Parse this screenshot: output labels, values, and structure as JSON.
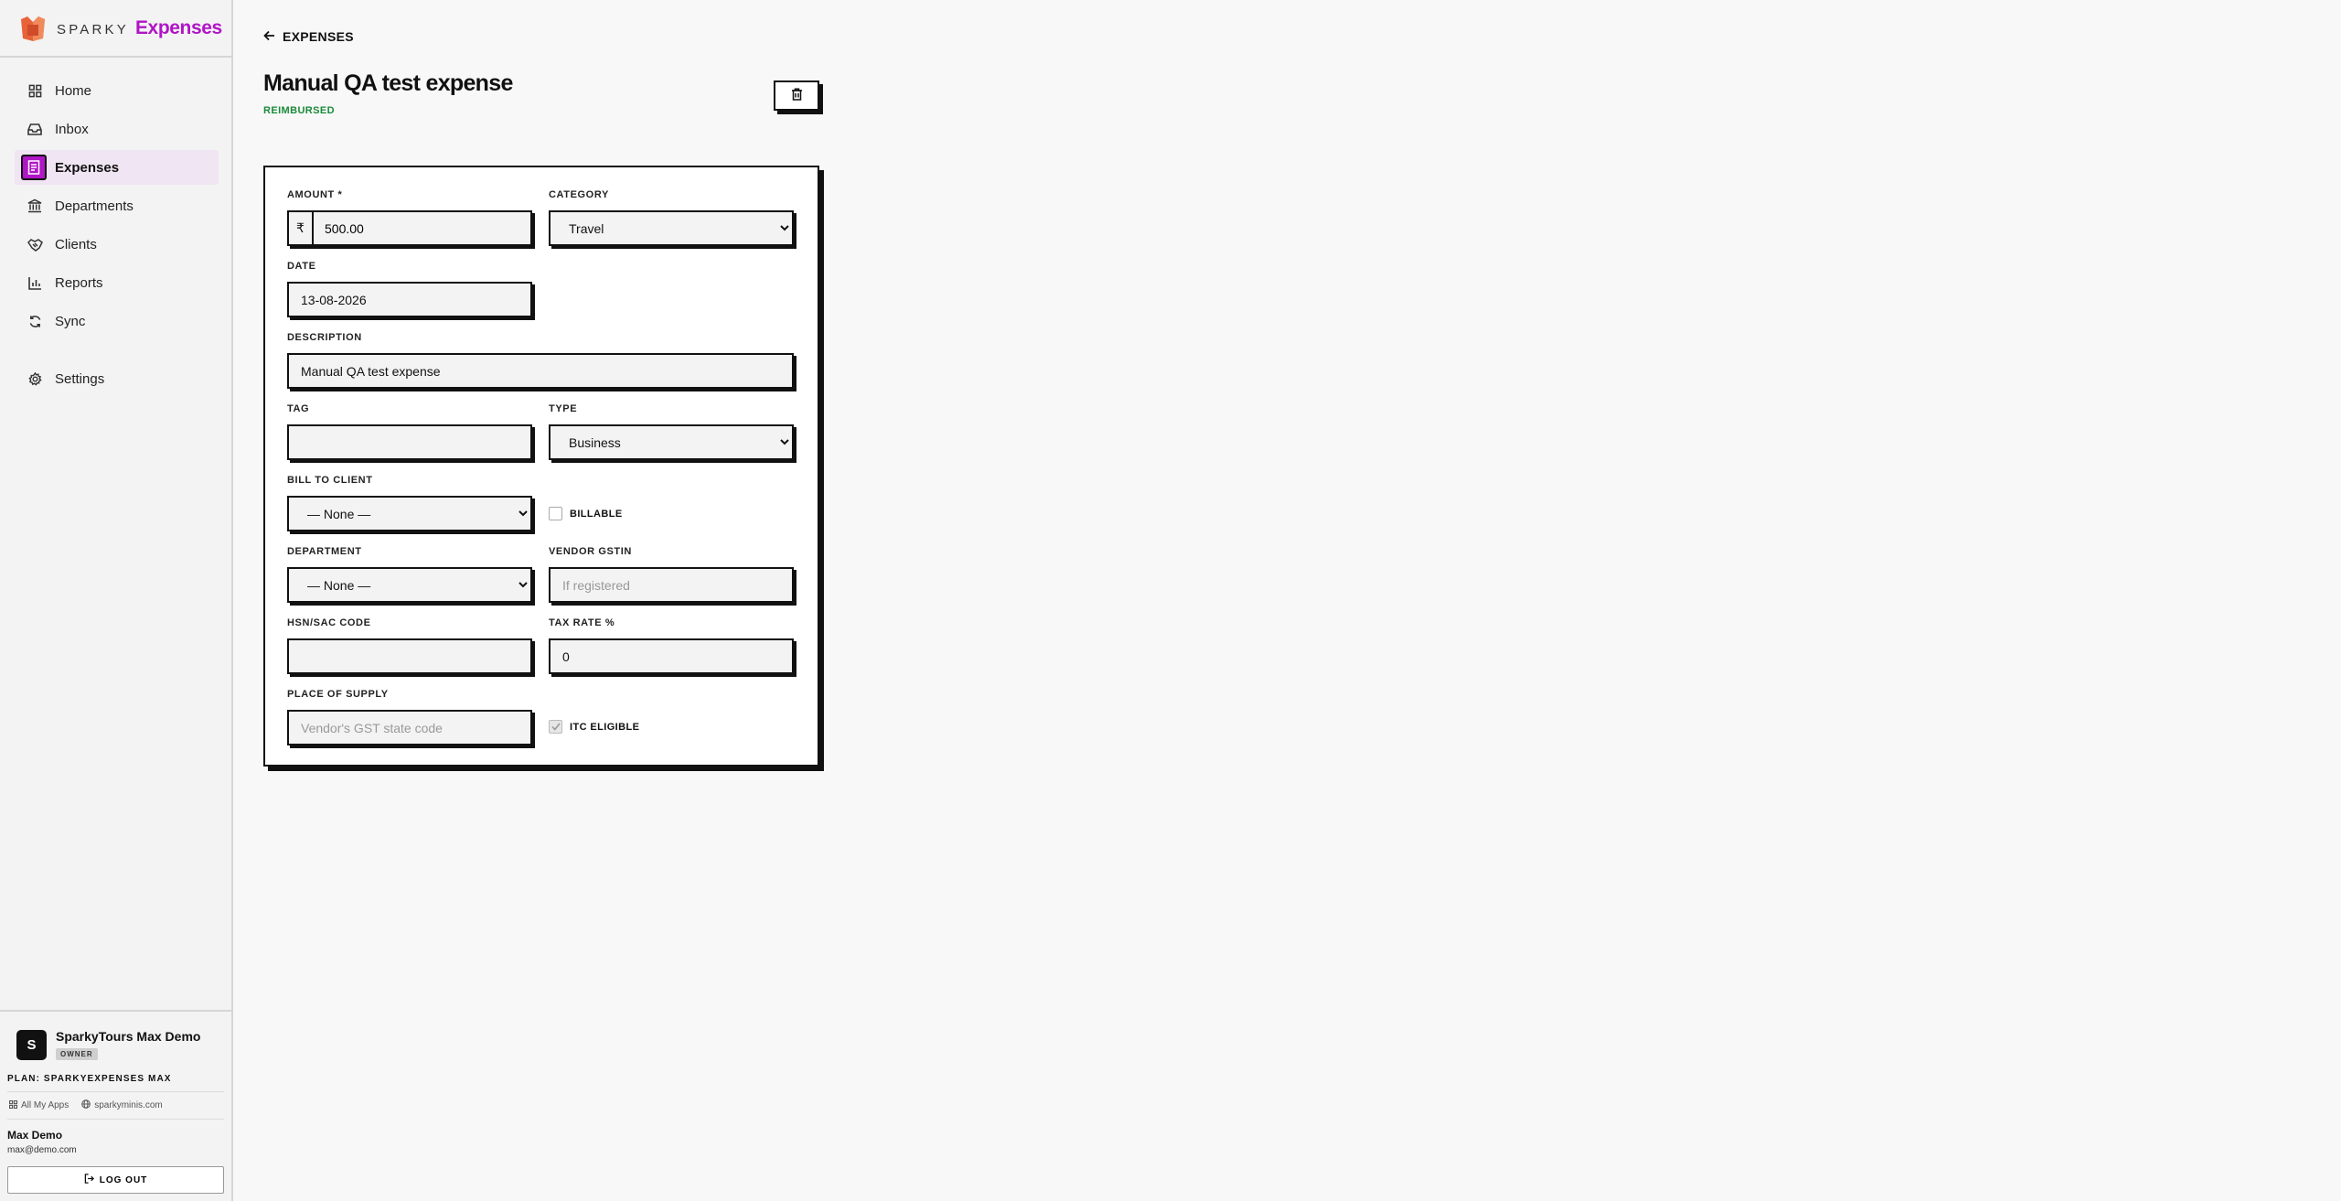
{
  "brand": {
    "name": "SPARKY",
    "app": "Expenses"
  },
  "nav": {
    "home": "Home",
    "inbox": "Inbox",
    "expenses": "Expenses",
    "departments": "Departments",
    "clients": "Clients",
    "reports": "Reports",
    "sync": "Sync",
    "settings": "Settings"
  },
  "org": {
    "initial": "S",
    "name": "SparkyTours Max Demo",
    "role": "OWNER"
  },
  "plan": "PLAN: SPARKYEXPENSES MAX",
  "links": {
    "apps": "All My Apps",
    "site": "sparkyminis.com"
  },
  "user": {
    "name": "Max Demo",
    "email": "max@demo.com"
  },
  "logout_label": "LOG OUT",
  "header": {
    "back_label": "EXPENSES",
    "title": "Manual QA test expense",
    "status": "REIMBURSED"
  },
  "colors": {
    "accent": "#b015c6",
    "status": "#1a8a38",
    "ink": "#111111"
  },
  "form": {
    "amount": {
      "label": "AMOUNT *",
      "currency": "₹",
      "value": "500.00"
    },
    "category": {
      "label": "CATEGORY",
      "value": "Travel"
    },
    "date": {
      "label": "DATE",
      "value": "13-08-2026"
    },
    "description": {
      "label": "DESCRIPTION",
      "value": "Manual QA test expense"
    },
    "tag": {
      "label": "TAG",
      "value": ""
    },
    "type": {
      "label": "TYPE",
      "value": "Business"
    },
    "bill_to_client": {
      "label": "BILL TO CLIENT",
      "value": "— None —"
    },
    "billable": {
      "label": "BILLABLE",
      "checked": false
    },
    "department": {
      "label": "DEPARTMENT",
      "value": "— None —"
    },
    "vendor_gstin": {
      "label": "VENDOR GSTIN",
      "placeholder": "If registered",
      "value": ""
    },
    "hsn": {
      "label": "HSN/SAC CODE",
      "value": ""
    },
    "tax_rate": {
      "label": "TAX RATE %",
      "value": "0"
    },
    "place_of_supply": {
      "label": "PLACE OF SUPPLY",
      "placeholder": "Vendor's GST state code",
      "value": ""
    },
    "itc": {
      "label": "ITC ELIGIBLE",
      "checked": true
    }
  }
}
